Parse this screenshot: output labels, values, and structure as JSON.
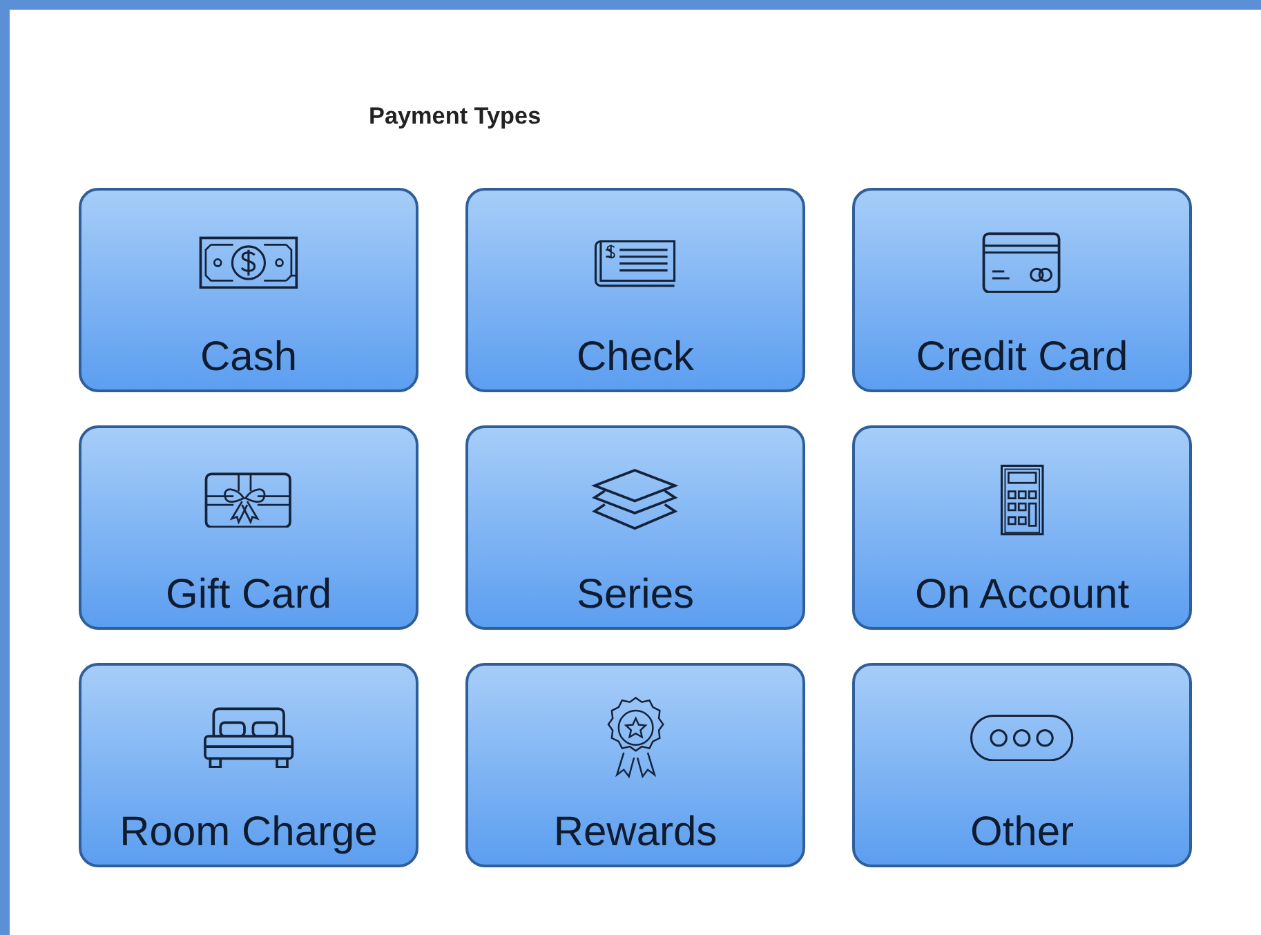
{
  "title": "Payment Types",
  "buttons": [
    {
      "label": "Cash",
      "kind": "cash"
    },
    {
      "label": "Check",
      "kind": "check"
    },
    {
      "label": "Credit Card",
      "kind": "credit"
    },
    {
      "label": "Gift Card",
      "kind": "gift"
    },
    {
      "label": "Series",
      "kind": "layers"
    },
    {
      "label": "On Account",
      "kind": "calculator"
    },
    {
      "label": "Room Charge",
      "kind": "bed"
    },
    {
      "label": "Rewards",
      "kind": "award"
    },
    {
      "label": "Other",
      "kind": "dots"
    }
  ]
}
